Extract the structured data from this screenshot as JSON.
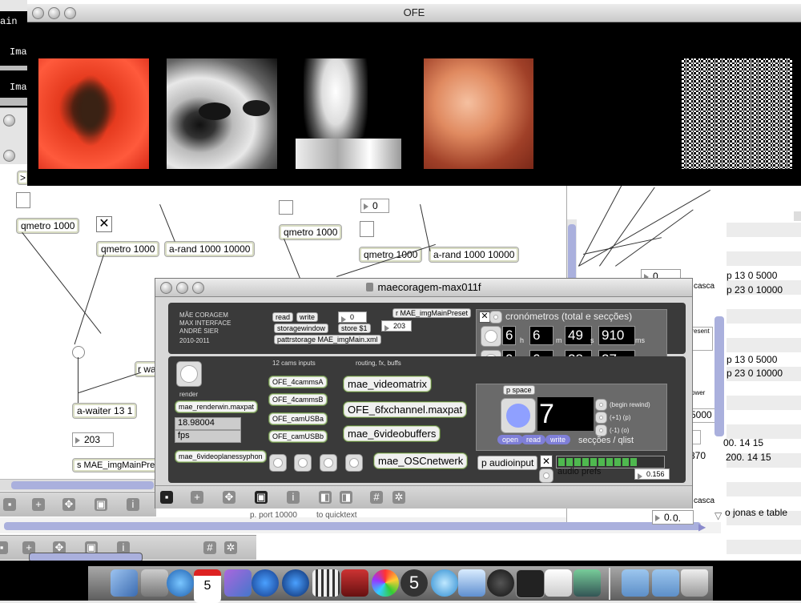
{
  "ofe_window": {
    "title": "OFE"
  },
  "bg_patch": {
    "left_text": [
      "ain",
      "Ima",
      "Ima"
    ],
    "objects": {
      "qmetro_a": "qmetro 1000",
      "qmetro_b": "qmetro 1000",
      "qmetro_c": "qmetro 1000",
      "qmetro_d": "qmetro 1000",
      "arand_a": "a-rand 1000 10000",
      "arand_b": "a-rand 1000 10000",
      "awaiter": "a-waiter 13 1",
      "rwa": "r wa",
      "num_203": "203",
      "smae": "s MAE_imgMainPreset",
      "num_0_top": "0",
      "gt": ">"
    },
    "right_objects": {
      "n0a": "0.",
      "n0b": "0.",
      "line1": "p 13 0 5000",
      "line2": "p 23 0 10000",
      "line3": "p 13 0 5000",
      "line4": "p 23 0 10000",
      "cascade1": "casca",
      "cascade2": "casca",
      "present": "present",
      "power": "ower",
      "v5000": "5000",
      "v200a": "200. 14 15",
      "v200b": "200. 14 15",
      "v870": "870",
      "v00": "00. 14 15",
      "jonas": "o jonas e table",
      "zero": "0."
    },
    "bottom_text": {
      "port": "p. port 10000",
      "quit": "to quicktext"
    }
  },
  "mae_window": {
    "title": "maecoragem-max011f",
    "header_lines": [
      "MÃE CORAGEM",
      "MAX INTERFACE",
      "ANDRÉ SIER",
      "2010-2011"
    ],
    "storage": {
      "read": "read",
      "write": "write",
      "num0": "0",
      "storagewindow": "storagewindow",
      "store": "store $1",
      "r_preset": "r MAE_imgMainPreset",
      "num203": "203",
      "pattr": "pattrstorage MAE_imgMain.xml"
    },
    "render": {
      "label": "render",
      "renderwin": "mae_renderwin.maxpat",
      "fps_value": "18.98004",
      "fps_label": "fps",
      "syphon": "mae_6videoplanessyphon"
    },
    "cams": {
      "title": "12 cams inputs",
      "items": [
        "OFE_4cammsA",
        "OFE_4cammsB",
        "OFE_camUSBa",
        "OFE_camUSBb"
      ]
    },
    "routing": {
      "title": "routing, fx, buffs",
      "items": [
        "mae_videomatrix",
        "OFE_6fxchannel.maxpat",
        "mae_6videobuffers"
      ]
    },
    "osc": "mae_OSCnetwerk",
    "cronometros": {
      "title": "cronómetros (total e secções)",
      "row1": {
        "h": "6",
        "m": "6",
        "s": "49",
        "ms": "910"
      },
      "row2": {
        "h": "0",
        "m": "6",
        "s": "28",
        "ms": "27"
      },
      "units": {
        "h": "h",
        "m": "m",
        "s": "s",
        "ms": "ms"
      }
    },
    "qlist": {
      "space": "p space",
      "number": "7",
      "begin": "(begin rewind)",
      "plus": "(+1) (p)",
      "minus": "(-1) (o)",
      "open": "open",
      "read": "read",
      "write": "write",
      "label": "secções / qlist"
    },
    "audio": {
      "input": "p audioinput",
      "prefs": "audio prefs",
      "level": "0.156",
      "meter_fraction": 0.75
    }
  },
  "dock": {
    "calendar_day": "5",
    "badge_five": "5"
  },
  "colors": {
    "accent": "#7f7fd8",
    "dark_panel": "#3a3a3a",
    "green_box": "#6c8c4c"
  }
}
